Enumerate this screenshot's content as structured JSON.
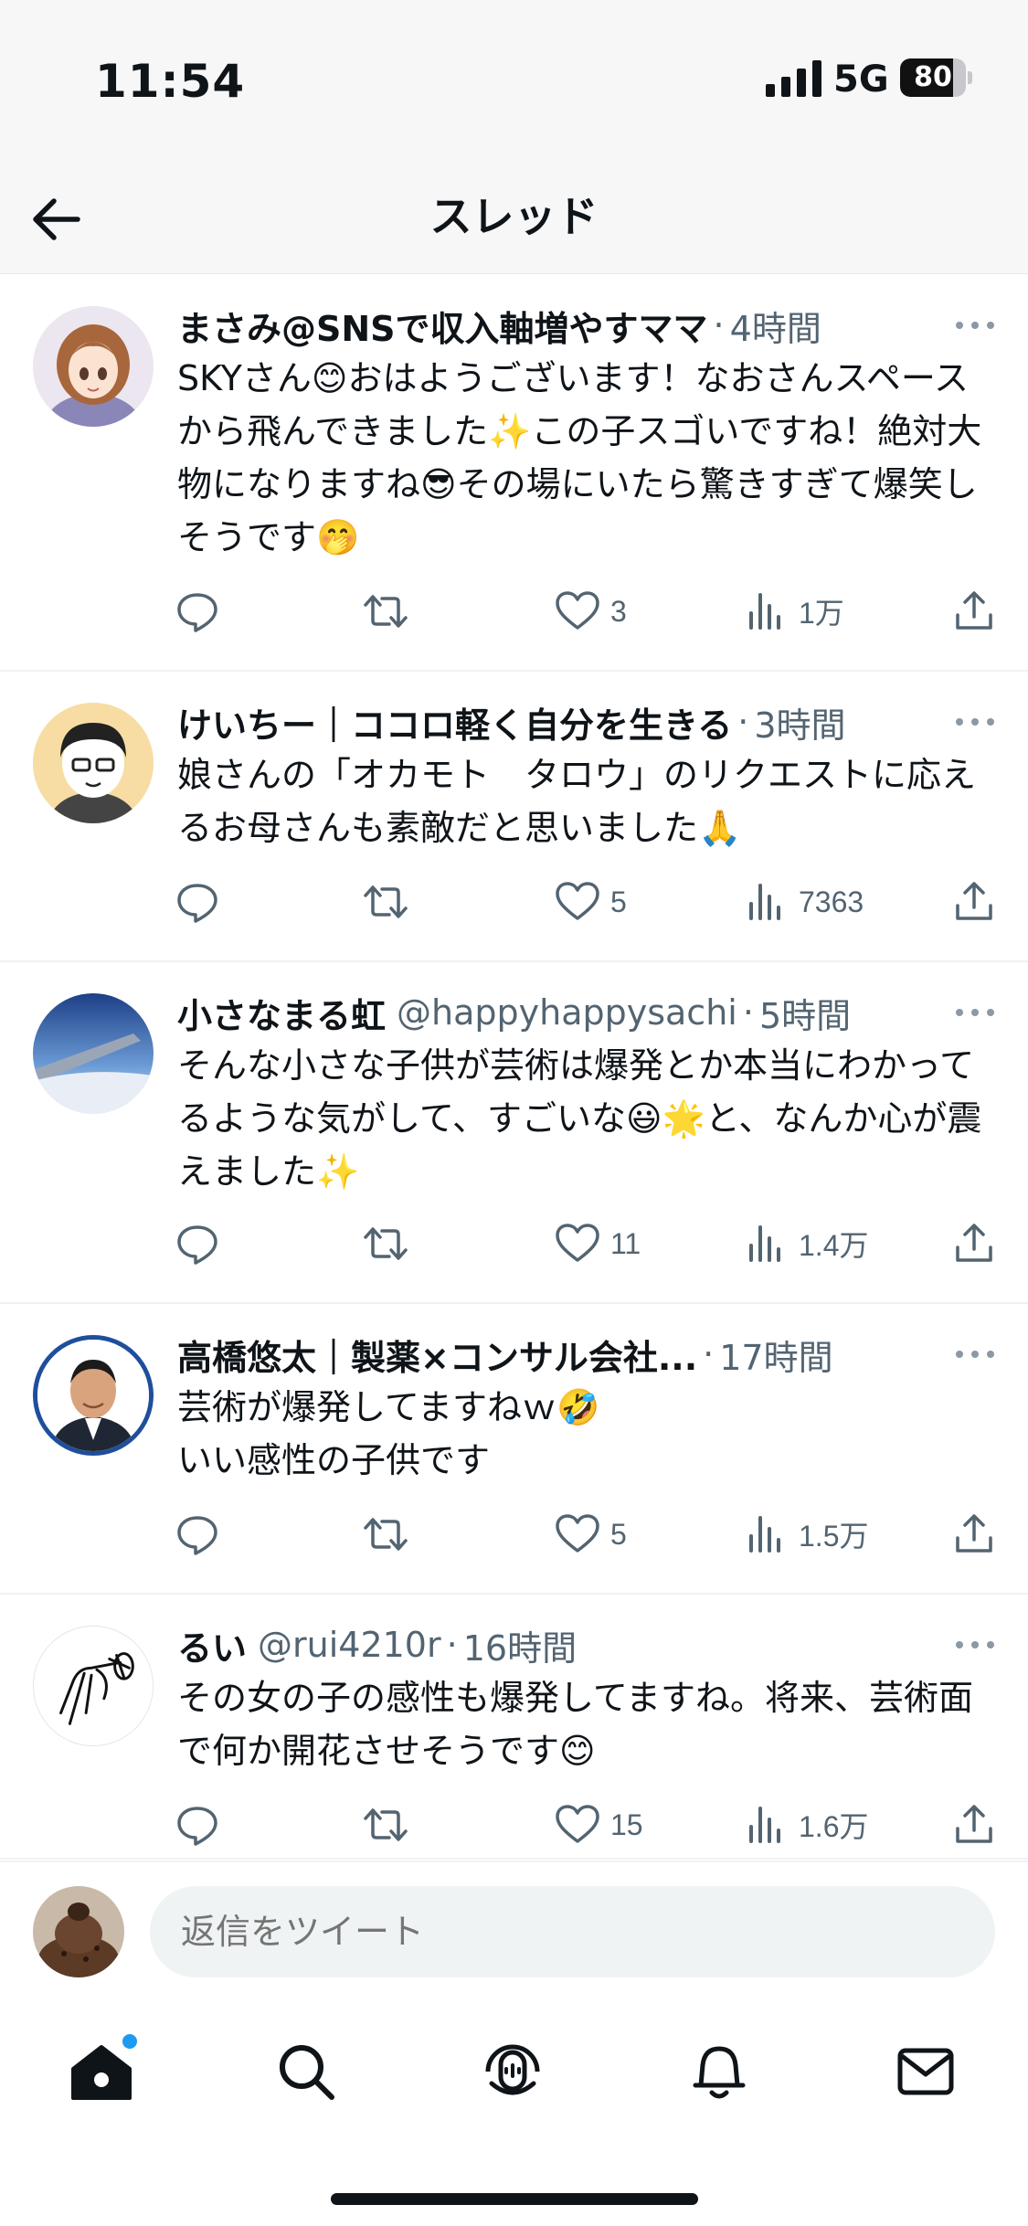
{
  "status_bar": {
    "time": "11:54",
    "network": "5G",
    "battery": "80",
    "battery_level": 0.8
  },
  "header": {
    "title": "スレッド"
  },
  "tweets": [
    {
      "name": "まさみ@SNSで収入軸増やすママ",
      "handle": "",
      "time": "4時間",
      "text": "SKYさん😊おはようございます！なおさんスペースから飛んできました✨この子スゴいですね！絶対大物になりますね😎その場にいたら驚きすぎて爆笑しそうです🤭",
      "likes": "3",
      "views": "1万"
    },
    {
      "name": "けいちー｜ココロ軽く自分を生きる",
      "handle": "",
      "time": "3時間",
      "text": "娘さんの「オカモト　タロウ」のリクエストに応えるお母さんも素敵だと思いました🙏",
      "likes": "5",
      "views": "7363"
    },
    {
      "name": "小さなまる虹",
      "handle": "@happyhappysachi",
      "time": "5時間",
      "text": "そんな小さな子供が芸術は爆発とか本当にわかってるような気がして、すごいな😃🌟と、なんか心が震えました✨",
      "likes": "11",
      "views": "1.4万"
    },
    {
      "name": "高橋悠太｜製薬×コンサル会社...",
      "handle": "",
      "time": "17時間",
      "text": "芸術が爆発してますねｗ🤣\nいい感性の子供です",
      "likes": "5",
      "views": "1.5万"
    },
    {
      "name": "るい",
      "handle": "@rui4210r",
      "time": "16時間",
      "text": "その女の子の感性も爆発してますね。将来、芸術面で何か開花させそうです😊",
      "likes": "15",
      "views": "1.6万"
    }
  ],
  "reply": {
    "placeholder": "返信をツイート"
  },
  "icons": {
    "back": "arrow-left-icon",
    "more": "more-horizontal-icon",
    "reply": "comment-bubble-icon",
    "retweet": "retweet-icon",
    "like": "heart-icon",
    "views": "analytics-bar-icon",
    "share": "share-upload-icon",
    "nav": [
      "home-icon",
      "search-icon",
      "spaces-icon",
      "bell-icon",
      "mail-icon"
    ]
  },
  "colors": {
    "accent": "#1d9bf0",
    "text": "#0f1419",
    "secondary": "#536471"
  }
}
